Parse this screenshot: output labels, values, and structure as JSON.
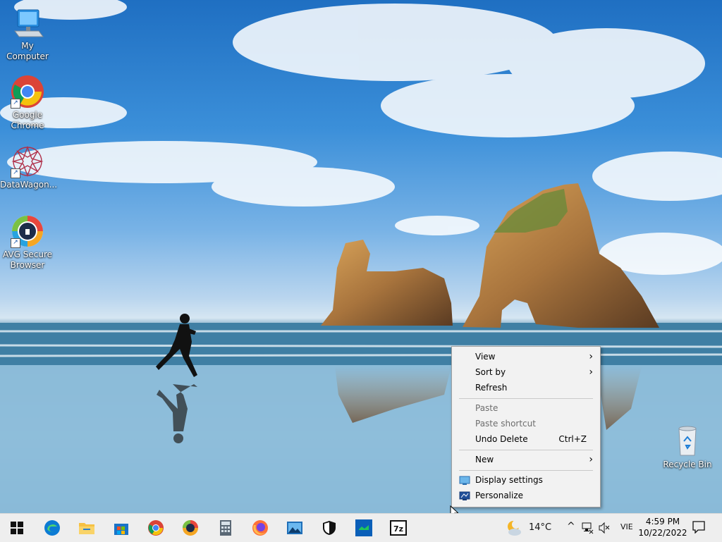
{
  "desktop": {
    "icons": [
      {
        "label": "My Computer",
        "icon": "computer-icon"
      },
      {
        "label": "Google Chrome",
        "icon": "chrome-icon"
      },
      {
        "label": "DataWagon...",
        "icon": "datawagon-icon"
      },
      {
        "label": "AVG Secure Browser",
        "icon": "avg-secure-browser-icon"
      },
      {
        "label": "Recycle Bin",
        "icon": "recycle-bin-icon"
      }
    ]
  },
  "context_menu": {
    "items": [
      {
        "label": "View",
        "submenu": true,
        "enabled": true
      },
      {
        "label": "Sort by",
        "submenu": true,
        "enabled": true
      },
      {
        "label": "Refresh",
        "enabled": true
      },
      {
        "label": "Paste",
        "enabled": false
      },
      {
        "label": "Paste shortcut",
        "enabled": false
      },
      {
        "label": "Undo Delete",
        "shortcut": "Ctrl+Z",
        "enabled": true
      },
      {
        "label": "New",
        "submenu": true,
        "enabled": true
      },
      {
        "label": "Display settings",
        "icon": "display-settings-icon",
        "enabled": true
      },
      {
        "label": "Personalize",
        "icon": "personalize-icon",
        "enabled": true
      }
    ],
    "arrow_glyph": "›"
  },
  "taskbar": {
    "pinned": [
      {
        "name": "start-button"
      },
      {
        "name": "edge-icon"
      },
      {
        "name": "file-explorer-icon"
      },
      {
        "name": "microsoft-store-icon"
      },
      {
        "name": "chrome-taskbar-icon"
      },
      {
        "name": "avg-browser-taskbar-icon"
      },
      {
        "name": "calculator-icon"
      },
      {
        "name": "firefox-icon"
      },
      {
        "name": "photos-icon"
      },
      {
        "name": "security-shield-icon"
      },
      {
        "name": "green-app-icon"
      },
      {
        "name": "7zip-icon"
      }
    ],
    "seven_zip_label": "7z",
    "weather": {
      "temperature": "14°C"
    },
    "tray": {
      "chevron": "^",
      "language": "VIE",
      "time": "4:59 PM",
      "date": "10/22/2022"
    }
  },
  "colors": {
    "taskbar_bg": "#eeeeee",
    "menu_bg": "#f2f2f2",
    "accent": "#0078d4"
  }
}
